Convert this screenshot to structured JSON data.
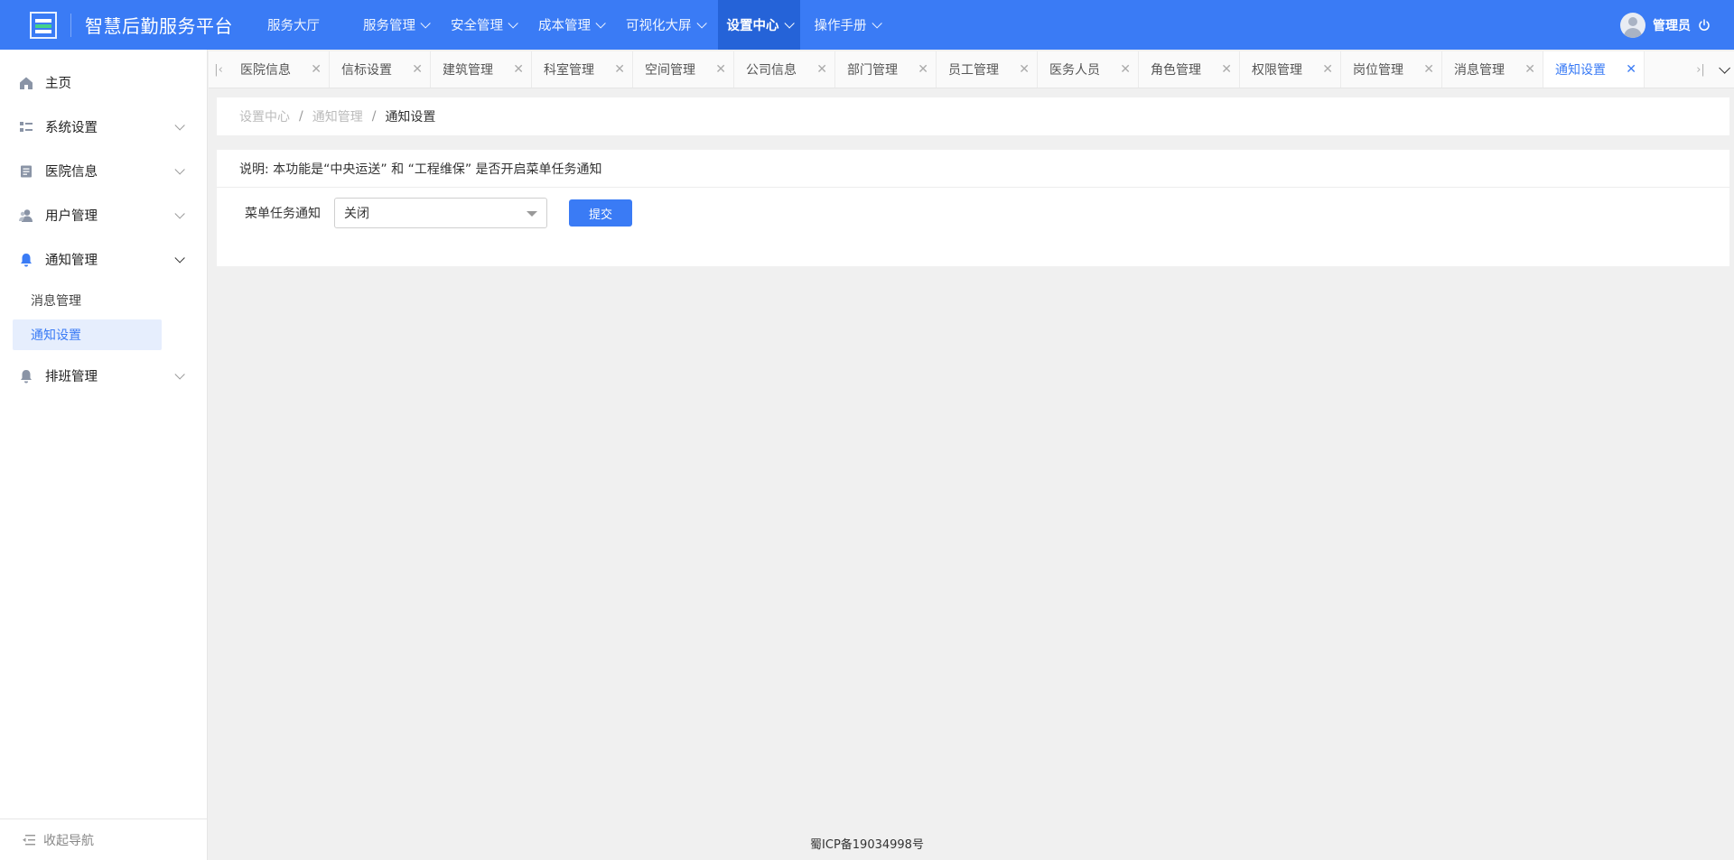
{
  "header": {
    "title": "智慧后勤服务平台",
    "nav": [
      {
        "label": "服务大厅",
        "dropdown": false
      },
      {
        "label": "服务管理",
        "dropdown": true
      },
      {
        "label": "安全管理",
        "dropdown": true
      },
      {
        "label": "成本管理",
        "dropdown": true
      },
      {
        "label": "可视化大屏",
        "dropdown": true
      },
      {
        "label": "设置中心",
        "dropdown": true,
        "active": true
      },
      {
        "label": "操作手册",
        "dropdown": true
      }
    ],
    "username": "管理员"
  },
  "sidebar": {
    "items": [
      {
        "label": "主页",
        "icon": "home-icon"
      },
      {
        "label": "系统设置",
        "icon": "grid-list-icon"
      },
      {
        "label": "医院信息",
        "icon": "document-icon"
      },
      {
        "label": "用户管理",
        "icon": "users-icon"
      },
      {
        "label": "通知管理",
        "icon": "bell-icon",
        "open": true,
        "children": [
          {
            "label": "消息管理"
          },
          {
            "label": "通知设置",
            "active": true
          }
        ]
      },
      {
        "label": "排班管理",
        "icon": "bell-icon"
      }
    ],
    "collapse_label": "收起导航"
  },
  "tabs": [
    {
      "label": "医院信息"
    },
    {
      "label": "信标设置"
    },
    {
      "label": "建筑管理"
    },
    {
      "label": "科室管理"
    },
    {
      "label": "空间管理"
    },
    {
      "label": "公司信息"
    },
    {
      "label": "部门管理"
    },
    {
      "label": "员工管理"
    },
    {
      "label": "医务人员"
    },
    {
      "label": "角色管理"
    },
    {
      "label": "权限管理"
    },
    {
      "label": "岗位管理"
    },
    {
      "label": "消息管理"
    },
    {
      "label": "通知设置",
      "active": true
    }
  ],
  "breadcrumb": {
    "items": [
      "设置中心",
      "通知管理"
    ],
    "current": "通知设置"
  },
  "form": {
    "notice": "说明: 本功能是“中央运送” 和 “工程维保” 是否开启菜单任务通知",
    "field_label": "菜单任务通知",
    "select_value": "关闭",
    "submit_label": "提交"
  },
  "footer": {
    "icp": "蜀ICP备19034998号"
  },
  "colors": {
    "primary": "#3a7bf5",
    "header_active": "#2563d8",
    "submenu_active_bg": "#e6eefd",
    "page_bg": "#f0f0f0"
  }
}
